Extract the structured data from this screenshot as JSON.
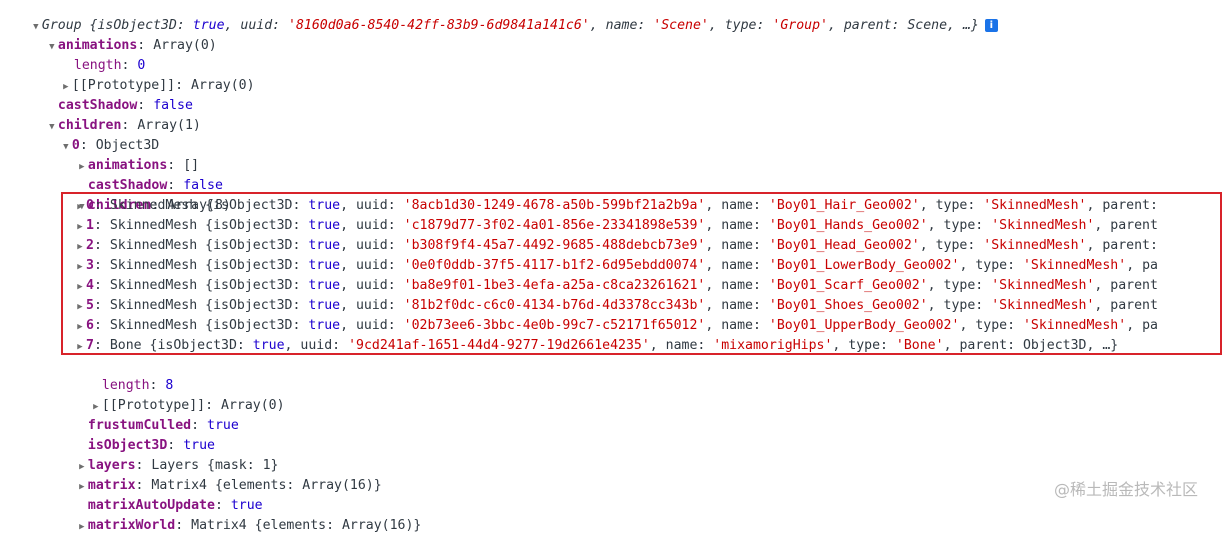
{
  "root": {
    "label": "Group",
    "summary_pre": " {isObject3D: ",
    "isObject3D": "true",
    "uuid_key": ", uuid: ",
    "uuid": "'8160d0a6-8540-42ff-83b9-6d9841a141c6'",
    "name_key": ", name: ",
    "name": "'Scene'",
    "type_key": ", type: ",
    "type": "'Group'",
    "tail": ", parent: Scene, …}",
    "info_icon": "i"
  },
  "rows": {
    "animations": {
      "key": "animations",
      "value": "Array(0)"
    },
    "anim_length": {
      "key": "length",
      "value": "0"
    },
    "anim_proto": {
      "key": "[[Prototype]]",
      "value": "Array(0)"
    },
    "castShadow": {
      "key": "castShadow",
      "value": "false"
    },
    "children": {
      "key": "children",
      "value": "Array(1)"
    },
    "child0": {
      "key": "0",
      "value": "Object3D"
    },
    "c0_animations": {
      "key": "animations",
      "value": "[]"
    },
    "c0_castShadow": {
      "key": "castShadow",
      "value": "false"
    },
    "c0_children": {
      "key": "children",
      "value": "Array(8)"
    },
    "c0_length": {
      "key": "length",
      "value": "8"
    },
    "c0_proto": {
      "key": "[[Prototype]]",
      "value": "Array(0)"
    },
    "frustumCulled": {
      "key": "frustumCulled",
      "value": "true"
    },
    "isObject3D": {
      "key": "isObject3D",
      "value": "true"
    },
    "layers": {
      "key": "layers",
      "value": "Layers {mask: 1}"
    },
    "matrix": {
      "key": "matrix",
      "value": "Matrix4 {elements: Array(16)}"
    },
    "matrixAutoUpdate": {
      "key": "matrixAutoUpdate",
      "value": "true"
    },
    "matrixWorld": {
      "key": "matrixWorld",
      "value": "Matrix4 {elements: Array(16)}"
    }
  },
  "meshes": [
    {
      "idx": "0",
      "cls": "SkinnedMesh",
      "uuid": "'8acb1d30-1249-4678-a50b-599bf21a2b9a'",
      "name": "'Boy01_Hair_Geo002'",
      "type": "'SkinnedMesh'",
      "tail": ", parent:"
    },
    {
      "idx": "1",
      "cls": "SkinnedMesh",
      "uuid": "'c1879d77-3f02-4a01-856e-23341898e539'",
      "name": "'Boy01_Hands_Geo002'",
      "type": "'SkinnedMesh'",
      "tail": ", parent"
    },
    {
      "idx": "2",
      "cls": "SkinnedMesh",
      "uuid": "'b308f9f4-45a7-4492-9685-488debcb73e9'",
      "name": "'Boy01_Head_Geo002'",
      "type": "'SkinnedMesh'",
      "tail": ", parent:"
    },
    {
      "idx": "3",
      "cls": "SkinnedMesh",
      "uuid": "'0e0f0ddb-37f5-4117-b1f2-6d95ebdd0074'",
      "name": "'Boy01_LowerBody_Geo002'",
      "type": "'SkinnedMesh'",
      "tail": ", pa"
    },
    {
      "idx": "4",
      "cls": "SkinnedMesh",
      "uuid": "'ba8e9f01-1be3-4efa-a25a-c8ca23261621'",
      "name": "'Boy01_Scarf_Geo002'",
      "type": "'SkinnedMesh'",
      "tail": ", parent"
    },
    {
      "idx": "5",
      "cls": "SkinnedMesh",
      "uuid": "'81b2f0dc-c6c0-4134-b76d-4d3378cc343b'",
      "name": "'Boy01_Shoes_Geo002'",
      "type": "'SkinnedMesh'",
      "tail": ", parent"
    },
    {
      "idx": "6",
      "cls": "SkinnedMesh",
      "uuid": "'02b73ee6-3bbc-4e0b-99c7-c52171f65012'",
      "name": "'Boy01_UpperBody_Geo002'",
      "type": "'SkinnedMesh'",
      "tail": ", pa"
    },
    {
      "idx": "7",
      "cls": "Bone",
      "uuid": "'9cd241af-1651-44d4-9277-19d2661e4235'",
      "name": "'mixamorigHips'",
      "type": "'Bone'",
      "tail": ", parent: Object3D, …}"
    }
  ],
  "labels": {
    "open_brace": " {isObject3D: ",
    "true": "true",
    "uuid": ", uuid: ",
    "name": ", name: ",
    "type": ", type: ",
    "colon": ": "
  },
  "watermark": "@稀土掘金技术社区",
  "colors": {
    "key": "#881280",
    "string": "#c80000",
    "keyword": "#1c00cf",
    "highlight_border": "#d8232a"
  }
}
